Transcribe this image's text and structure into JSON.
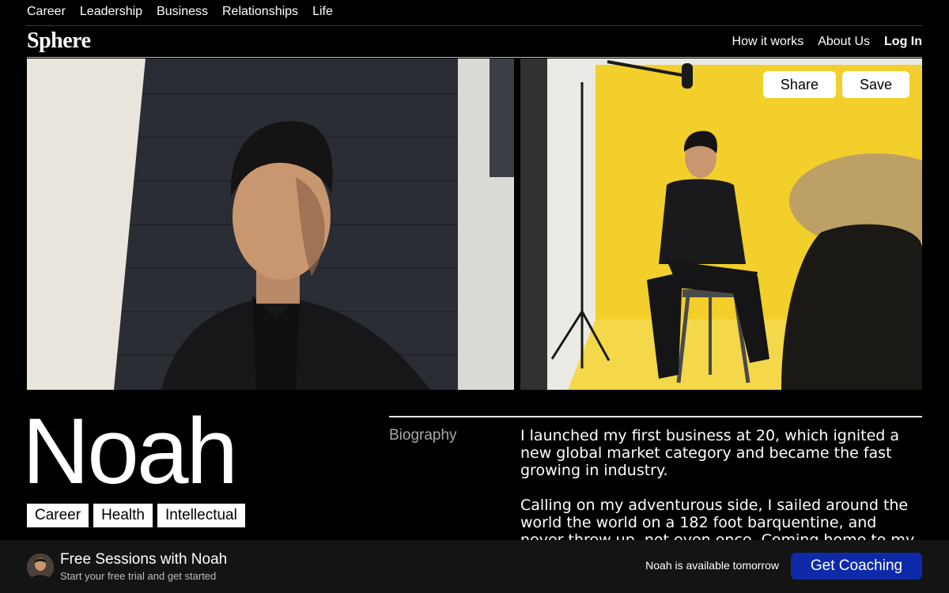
{
  "top_nav": [
    "Career",
    "Leadership",
    "Business",
    "Relationships",
    "Life"
  ],
  "brand": "Sphere",
  "right_nav": {
    "how": "How it works",
    "about": "About Us",
    "login": "Log In"
  },
  "photo_actions": {
    "share": "Share",
    "save": "Save"
  },
  "profile": {
    "name": "Noah",
    "tags": [
      "Career",
      "Health",
      "Intellectual"
    ]
  },
  "biography": {
    "label": "Biography",
    "paragraphs": [
      "I launched my first business at 20, which ignited a new global market category and became the fast growing in industry.",
      "Calling on my adventurous side, I sailed around the world the world on a 182 foot barquentine, and never threw up, not even once. Coming home to my roots, I’m"
    ]
  },
  "bottom_bar": {
    "title": "Free Sessions with Noah",
    "subtitle": "Start your free trial and get started",
    "availability": "Noah is available tomorrow",
    "cta": "Get Coaching"
  },
  "colors": {
    "background": "#000000",
    "cta": "#0e2aa9",
    "backdrop_yellow": "#f2cf2a"
  }
}
